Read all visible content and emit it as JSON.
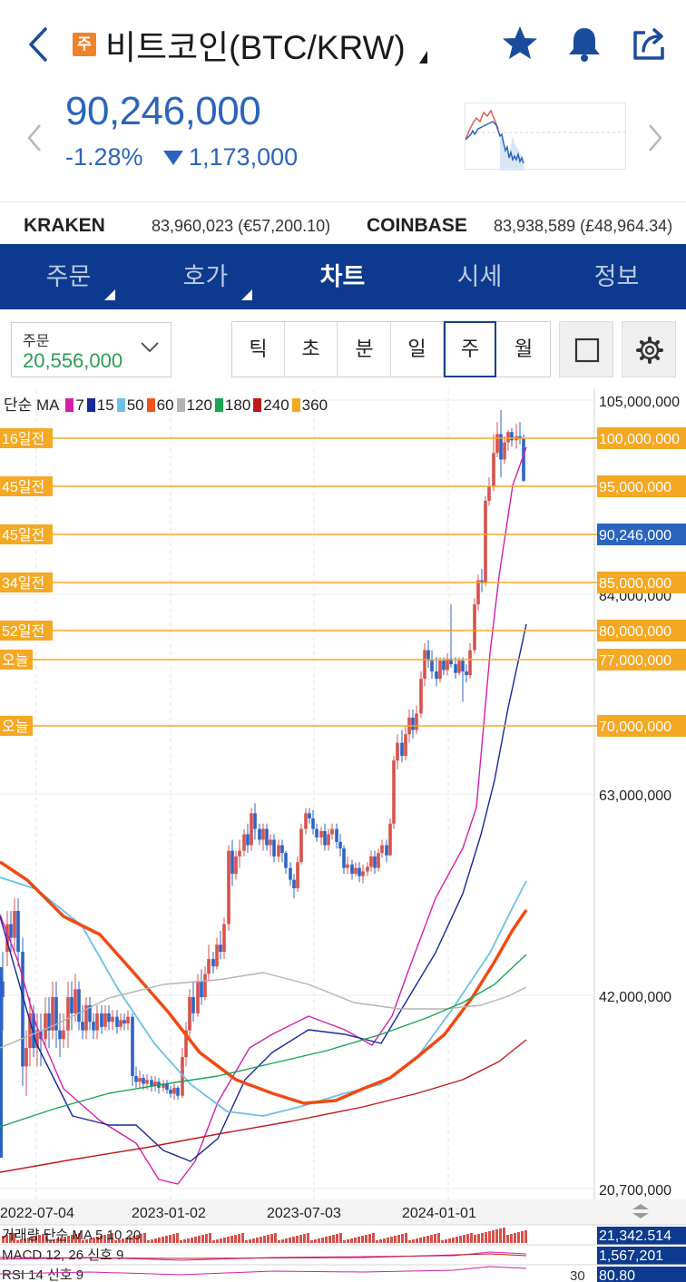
{
  "header": {
    "badge": "주",
    "title": "비트코인(BTC/KRW)",
    "icons": [
      "back-icon",
      "star-icon",
      "bell-icon",
      "share-icon"
    ]
  },
  "price": {
    "current": "90,246,000",
    "change_pct": "-1.28%",
    "change_amt": "1,173,000",
    "color": "#2b64bd"
  },
  "exchanges": [
    {
      "name": "KRAKEN",
      "value": "83,960,023 (€57,200.10)"
    },
    {
      "name": "COINBASE",
      "value": "83,938,589 (£48,964.34)"
    }
  ],
  "tabs": [
    {
      "label": "주문",
      "active": false
    },
    {
      "label": "호가",
      "active": false
    },
    {
      "label": "차트",
      "active": true
    },
    {
      "label": "시세",
      "active": false
    },
    {
      "label": "정보",
      "active": false
    }
  ],
  "order": {
    "label": "주문",
    "value": "20,556,000"
  },
  "periods": [
    "틱",
    "초",
    "분",
    "일",
    "주",
    "월"
  ],
  "selected_period": "주",
  "legend": {
    "prefix": "단순 MA",
    "items": [
      {
        "label": "7",
        "color": "#d61fa8"
      },
      {
        "label": "15",
        "color": "#16289a"
      },
      {
        "label": "50",
        "color": "#6cc0e6"
      },
      {
        "label": "60",
        "color": "#f0541e"
      },
      {
        "label": "120",
        "color": "#b3b3b3"
      },
      {
        "label": "180",
        "color": "#1aa553"
      },
      {
        "label": "240",
        "color": "#c0191c"
      },
      {
        "label": "360",
        "color": "#f4a823"
      }
    ]
  },
  "chart_data": {
    "type": "candlestick",
    "y_scale": "log",
    "y_ticks": [
      "105,000,000",
      "84,000,000",
      "63,000,000",
      "42,000,000",
      "20,700,000"
    ],
    "x_ticks": [
      "2022-07-04",
      "2023-01-02",
      "2023-07-03",
      "2024-01-01"
    ],
    "current_price_label": "90,246,000",
    "alert_lines": [
      {
        "left": "16일전",
        "right": "100,000,000",
        "value": 100000000
      },
      {
        "left": "45일전",
        "right": "95,000,000",
        "value": 95000000
      },
      {
        "left": "45일전",
        "right": "90,246,000",
        "value": 90246000
      },
      {
        "left": "34일전",
        "right": "85,000,000",
        "value": 85000000
      },
      {
        "left": "52일전",
        "right": "80,000,000",
        "value": 80000000
      },
      {
        "left": "오늘",
        "right": "77,000,000",
        "value": 77000000
      },
      {
        "left": "오늘",
        "right": "70,000,000",
        "value": 70000000
      }
    ],
    "sub_indicators": [
      {
        "label": "거래량 단순 MA 5 10 20",
        "value": "21,342.514"
      },
      {
        "label": "MACD 12, 26 신호 9",
        "value": "1,567,201"
      },
      {
        "label": "RSI 14 신호 9",
        "value": "80.80",
        "level": "30"
      }
    ]
  }
}
